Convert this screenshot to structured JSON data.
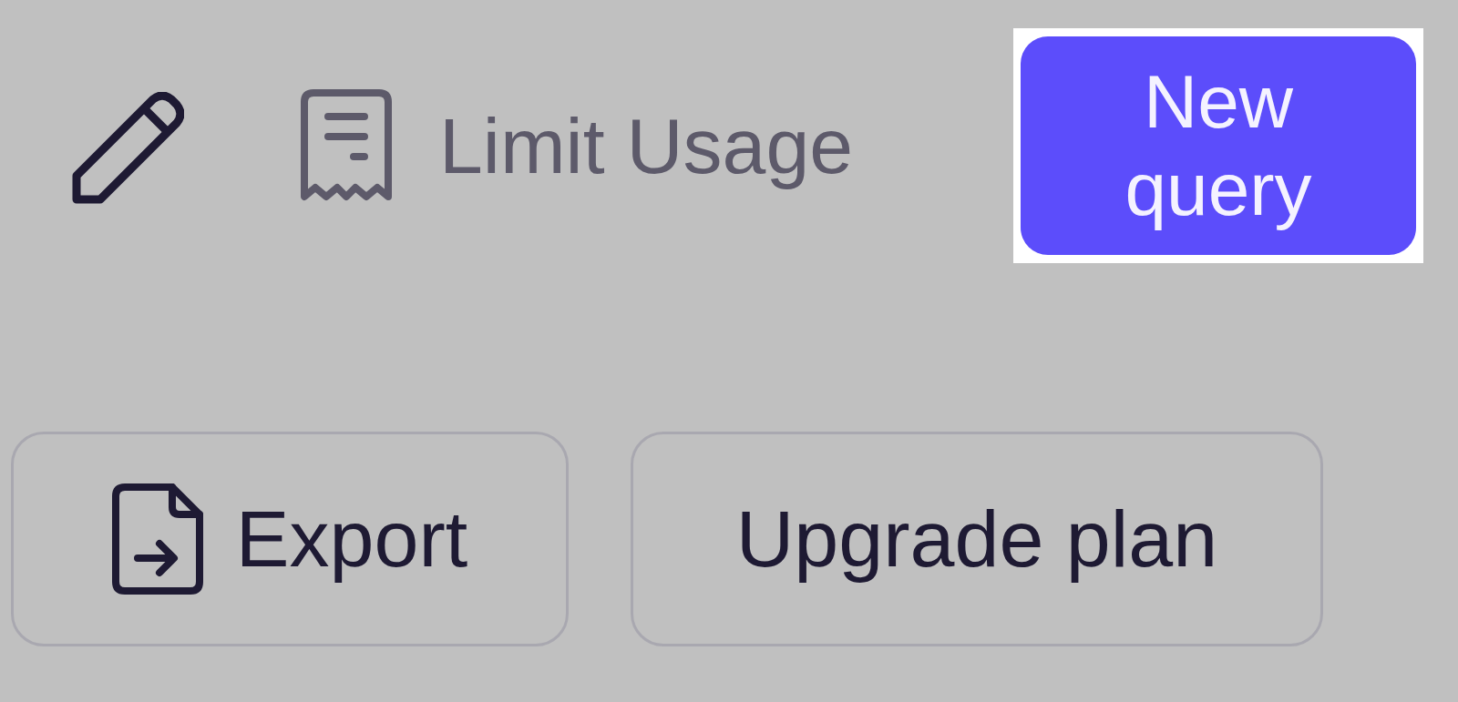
{
  "toolbar": {
    "limit_usage": "Limit Usage",
    "new_query": "New query"
  },
  "actions": [
    {
      "label": "Export",
      "kind": "export"
    },
    {
      "label": "Upgrade plan",
      "kind": "plain"
    }
  ]
}
